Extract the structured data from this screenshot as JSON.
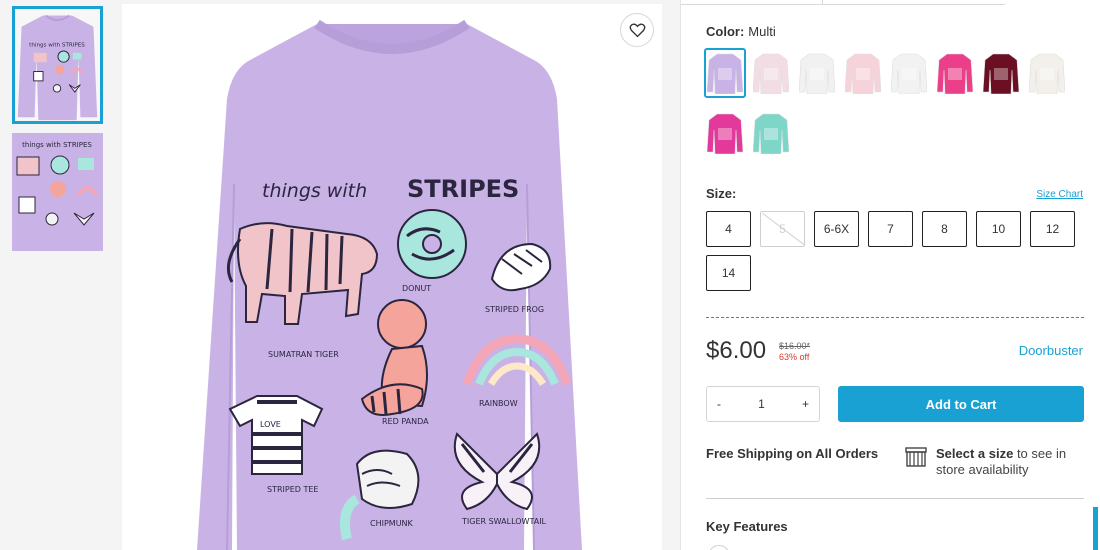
{
  "gallery": {
    "thumbnails": [
      {
        "name": "front-view",
        "selected": true
      },
      {
        "name": "graphic-closeup",
        "selected": false
      }
    ]
  },
  "shirt_graphic": {
    "headline_left": "things with",
    "headline_right": "STRIPES",
    "labels": {
      "tiger": "SUMATRAN TIGER",
      "donut": "DONUT",
      "frog": "STRIPED FROG",
      "panda": "RED PANDA",
      "rainbow": "RAINBOW",
      "tee": "STRIPED TEE",
      "tee_word": "LOVE",
      "chipmunk": "CHIPMUNK",
      "butterfly": "TIGER SWALLOWTAIL"
    }
  },
  "product": {
    "color_label": "Color:",
    "color_value": "Multi",
    "swatch_colors": [
      "#c9b3e6",
      "#f2dde5",
      "#f1f1f1",
      "#f6d3da",
      "#f2f2f2",
      "#ec3f89",
      "#6b0f23",
      "#f3f0eb",
      "#e2399b",
      "#7ed6c9"
    ],
    "size_label": "Size:",
    "size_chart": "Size Chart",
    "sizes": [
      "4",
      "5",
      "6-6X",
      "7",
      "8",
      "10",
      "12",
      "14"
    ],
    "price": "$6.00",
    "original_price": "$16.00*",
    "discount": "63% off",
    "doorbuster": "Doorbuster",
    "qty_minus": "-",
    "qty_value": "1",
    "qty_plus": "+",
    "add_to_cart": "Add to Cart",
    "free_shipping": "Free Shipping on All Orders",
    "select_size_bold": "Select a size",
    "select_size_rest": " to see in store availability",
    "key_features": "Key Features"
  },
  "colors": {
    "accent": "#1aa1d4",
    "shirt": "#c9b3e6",
    "sale": "#d9382c"
  }
}
